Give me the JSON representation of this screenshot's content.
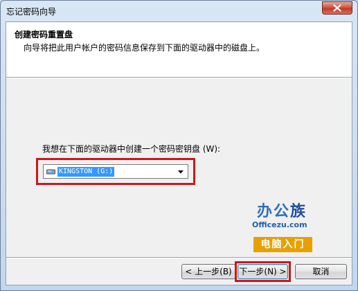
{
  "window": {
    "title": "忘记密码向导"
  },
  "header": {
    "title": "创建密码重置盘",
    "subtitle": "向导将把此用户帐户的密码信息保存到下面的驱动器中的磁盘上。"
  },
  "drive": {
    "label": "我想在下面的驱动器中创建一个密码密钥盘 (W):",
    "selected": "KINGSTON (G:)"
  },
  "watermark": {
    "logo_text_a": "办公",
    "logo_text_b": "族",
    "site": "Officezu.com",
    "tagline": "电脑入门"
  },
  "buttons": {
    "back": "< 上一步(B)",
    "next": "下一步(N) >",
    "cancel": "取消"
  },
  "colors": {
    "highlight": "#d0151c",
    "selection": "#3399ff",
    "close_button": "#c23a22"
  },
  "icons": [
    "close-icon",
    "usb-drive-icon",
    "chevron-down-icon"
  ]
}
